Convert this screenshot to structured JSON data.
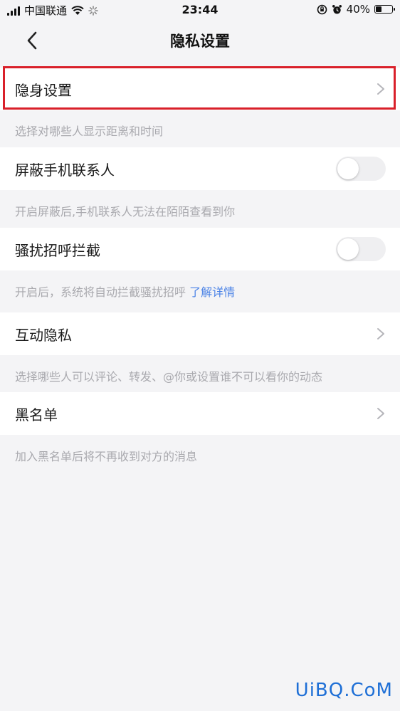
{
  "status_bar": {
    "carrier": "中国联通",
    "time": "23:44",
    "battery_text": "40%",
    "battery_level_percent": 40
  },
  "nav": {
    "title": "隐私设置",
    "back_icon": "chevron-left-icon"
  },
  "rows": {
    "stealth": {
      "label": "隐身设置",
      "note": "选择对哪些人显示距离和时间"
    },
    "block_contacts": {
      "label": "屏蔽手机联系人",
      "enabled": false,
      "note": "开启屏蔽后,手机联系人无法在陌陌查看到你"
    },
    "harass_block": {
      "label": "骚扰招呼拦截",
      "enabled": false,
      "note_prefix": "开启后，系统将自动拦截骚扰招呼",
      "note_link": "了解详情"
    },
    "interaction_privacy": {
      "label": "互动隐私",
      "note": "选择哪些人可以评论、转发、@你或设置谁不可以看你的动态"
    },
    "blacklist": {
      "label": "黑名单",
      "note": "加入黑名单后将不再收到对方的消息"
    }
  },
  "watermark": "UiBQ.CoM",
  "colors": {
    "background": "#f4f4f6",
    "highlight": "#d9202a",
    "link": "#4a82e6",
    "note_text": "#a9a9ae"
  }
}
